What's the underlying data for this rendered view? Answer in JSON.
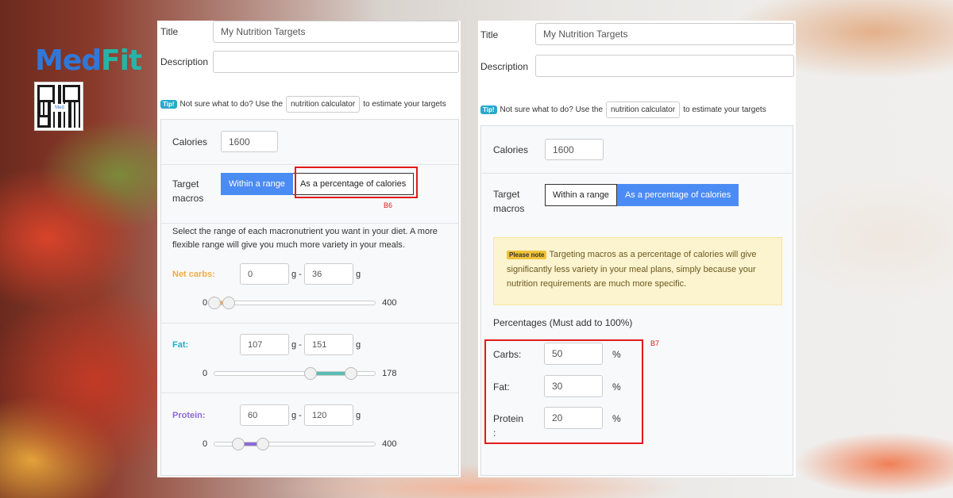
{
  "brand": {
    "logo_med": "Med",
    "logo_fit": "Fit",
    "qr_label": "Med"
  },
  "left": {
    "title_label": "Title",
    "title_value": "My Nutrition Targets",
    "description_label": "Description",
    "description_value": "",
    "tip_badge": "Tip!",
    "tip_before": "Not sure what to do? Use the",
    "tip_button": "nutrition calculator",
    "tip_after": "to estimate your targets",
    "calories_label": "Calories",
    "calories_value": "1600",
    "target_label_1": "Target",
    "target_label_2": "macros",
    "btn_range": "Within a range",
    "btn_percent": "As a percentage of calories",
    "annotation": "B6",
    "instructions": "Select the range of each macronutrient you want in your diet. A more flexible range will give you much more variety in your meals.",
    "macros": [
      {
        "label": "Net carbs:",
        "color": "#f0ad4e",
        "min": "0",
        "sep": "g -",
        "max": "36",
        "unit": "g",
        "slider_min": "0",
        "slider_max": "400",
        "low_fraction": 0.0,
        "high_fraction": 0.09,
        "fill_color": "#f0ad4e"
      },
      {
        "label": "Fat:",
        "color": "#27a9c9",
        "min": "107",
        "sep": "g -",
        "max": "151",
        "unit": "g",
        "slider_min": "0",
        "slider_max": "178",
        "low_fraction": 0.6,
        "high_fraction": 0.85,
        "fill_color": "#5bbdb3"
      },
      {
        "label": "Protein:",
        "color": "#8e6ad8",
        "min": "60",
        "sep": "g -",
        "max": "120",
        "unit": "g",
        "slider_min": "0",
        "slider_max": "400",
        "low_fraction": 0.15,
        "high_fraction": 0.3,
        "fill_color": "#8e6ad8"
      }
    ]
  },
  "right": {
    "title_label": "Title",
    "title_value": "My Nutrition Targets",
    "description_label": "Description",
    "description_value": "",
    "tip_badge": "Tip!",
    "tip_before": "Not sure what to do? Use the",
    "tip_button": "nutrition calculator",
    "tip_after": "to estimate your targets",
    "calories_label": "Calories",
    "calories_value": "1600",
    "target_label_1": "Target",
    "target_label_2": "macros",
    "btn_range": "Within a range",
    "btn_percent": "As a percentage of calories",
    "note_badge": "Please note",
    "note_text": "Targeting macros as a percentage of calories will give significantly less variety in your meal plans, simply because your nutrition requirements are much more specific.",
    "percentages_heading": "Percentages (Must add to 100%)",
    "annotation": "B7",
    "percentages": [
      {
        "label": "Carbs:",
        "value": "50",
        "unit": "%"
      },
      {
        "label": "Fat:",
        "value": "30",
        "unit": "%"
      },
      {
        "label": "Protein",
        "label_extra": ":",
        "value": "20",
        "unit": "%"
      }
    ]
  }
}
